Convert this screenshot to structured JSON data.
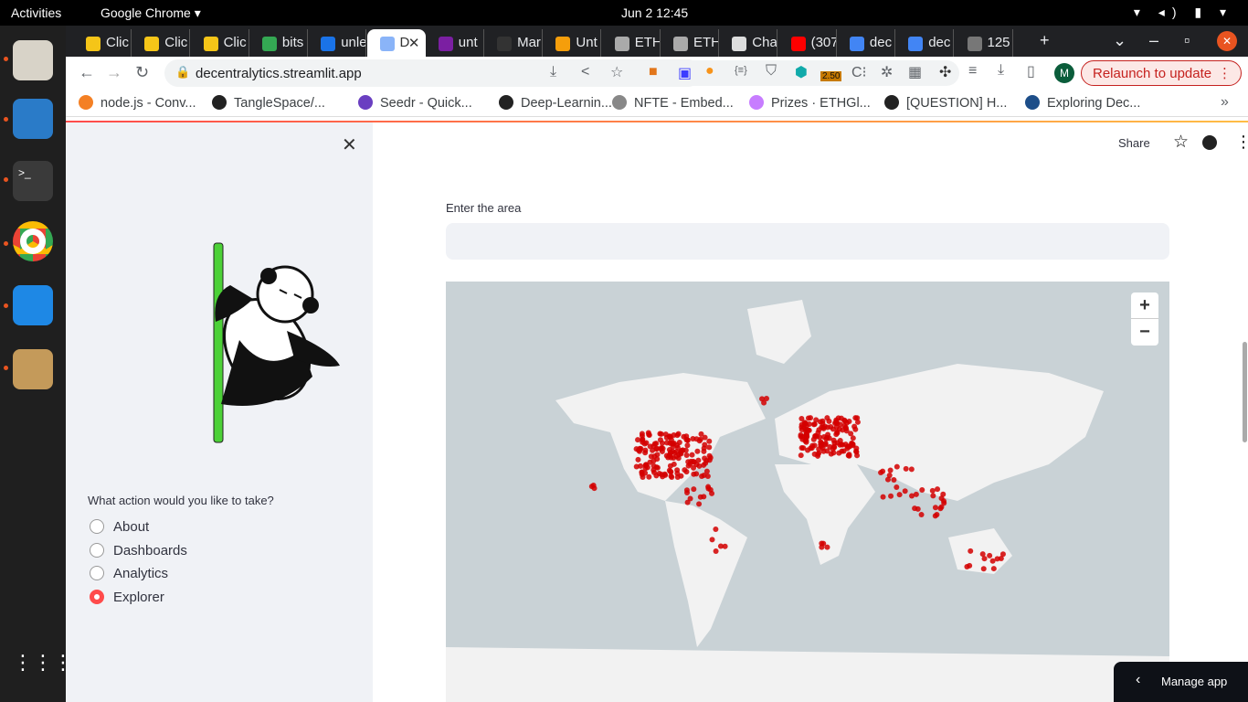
{
  "os": {
    "activities": "Activities",
    "app": "Google Chrome ▾",
    "clock": "Jun 2  12:45",
    "dock": [
      "files-icon",
      "image-viewer-icon",
      "terminal-icon",
      "chrome-icon",
      "vscode-icon",
      "archive-icon",
      "apps-grid-icon"
    ]
  },
  "tabs": [
    {
      "label": "Clic",
      "color": "#f5c518"
    },
    {
      "label": "Clic",
      "color": "#f5c518"
    },
    {
      "label": "Clic",
      "color": "#f5c518"
    },
    {
      "label": "bits",
      "color": "#34a853"
    },
    {
      "label": "unle",
      "color": "#1a73e8"
    },
    {
      "label": "D",
      "color": "#8ab4f8",
      "active": true
    },
    {
      "label": "unt",
      "color": "#7b1fa2"
    },
    {
      "label": "Mar",
      "color": "#333"
    },
    {
      "label": "Unt",
      "color": "#f59e0b"
    },
    {
      "label": "ETH",
      "color": "#aaa"
    },
    {
      "label": "ETH",
      "color": "#aaa"
    },
    {
      "label": "Cha",
      "color": "#ddd"
    },
    {
      "label": "(307",
      "color": "#ff0000"
    },
    {
      "label": "dec",
      "color": "#4285f4"
    },
    {
      "label": "dec",
      "color": "#4285f4"
    },
    {
      "label": "125",
      "color": "#777"
    }
  ],
  "toolbar": {
    "url": "decentralytics.streamlit.app",
    "relaunch": "Relaunch to update",
    "profile": "M",
    "badge": "2.50"
  },
  "bookmarks": [
    {
      "label": "node.js - Conv...",
      "color": "#f48024"
    },
    {
      "label": "TangleSpace/...",
      "color": "#222"
    },
    {
      "label": "Seedr - Quick...",
      "color": "#6a3fc1"
    },
    {
      "label": "Deep-Learnin...",
      "color": "#222"
    },
    {
      "label": "NFTE - Embed...",
      "color": "#888"
    },
    {
      "label": "Prizes · ETHGl...",
      "color": "#c77dff"
    },
    {
      "label": "[QUESTION] H...",
      "color": "#222"
    },
    {
      "label": "Exploring Dec...",
      "color": "#1d4e89"
    }
  ],
  "sidebar": {
    "question": "What action would you like to take?",
    "options": [
      {
        "label": "About",
        "selected": false
      },
      {
        "label": "Dashboards",
        "selected": false
      },
      {
        "label": "Analytics",
        "selected": false
      },
      {
        "label": "Explorer",
        "selected": true
      }
    ]
  },
  "header": {
    "share": "Share"
  },
  "main": {
    "area_label": "Enter the area",
    "area_value": "",
    "zoom_in": "+",
    "zoom_out": "−"
  },
  "manage": "Manage app",
  "colors": {
    "accent": "#ff4b4b",
    "marker": "#d40000",
    "ocean": "#c9d2d6",
    "land": "#f2f2f2"
  }
}
